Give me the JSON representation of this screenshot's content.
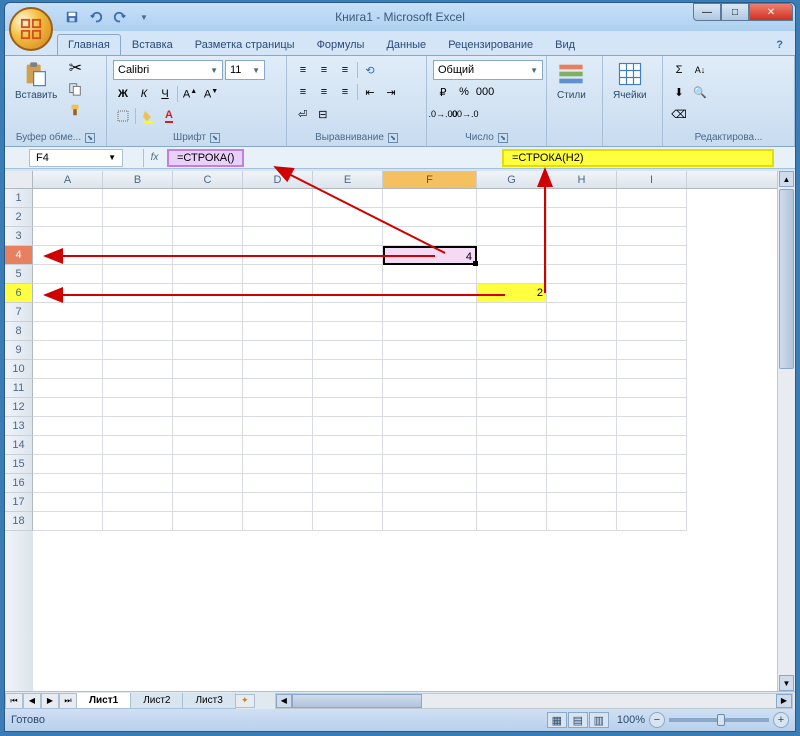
{
  "window": {
    "title": "Книга1 - Microsoft Excel"
  },
  "tabs": {
    "home": "Главная",
    "insert": "Вставка",
    "layout": "Разметка страницы",
    "formulas": "Формулы",
    "data": "Данные",
    "review": "Рецензирование",
    "view": "Вид"
  },
  "ribbon": {
    "clipboard": {
      "label": "Буфер обме...",
      "paste": "Вставить"
    },
    "font": {
      "label": "Шрифт",
      "family": "Calibri",
      "size": "11"
    },
    "alignment": {
      "label": "Выравнивание"
    },
    "number": {
      "label": "Число",
      "format": "Общий"
    },
    "styles": {
      "label": "Стили"
    },
    "cells": {
      "label": "Ячейки"
    },
    "editing": {
      "label": "Редактирова..."
    }
  },
  "formula_bar": {
    "name_box": "F4",
    "formula1": "=СТРОКА()",
    "formula2": "=СТРОКА(H2)"
  },
  "columns": [
    "A",
    "B",
    "C",
    "D",
    "E",
    "F",
    "G",
    "H",
    "I"
  ],
  "rows": [
    "1",
    "2",
    "3",
    "4",
    "5",
    "6",
    "7",
    "8",
    "9",
    "10",
    "11",
    "12",
    "13",
    "14",
    "15",
    "16",
    "17",
    "18"
  ],
  "cell_values": {
    "F4": "4",
    "G6": "2"
  },
  "sheets": {
    "s1": "Лист1",
    "s2": "Лист2",
    "s3": "Лист3"
  },
  "status": {
    "ready": "Готово",
    "zoom": "100%"
  }
}
